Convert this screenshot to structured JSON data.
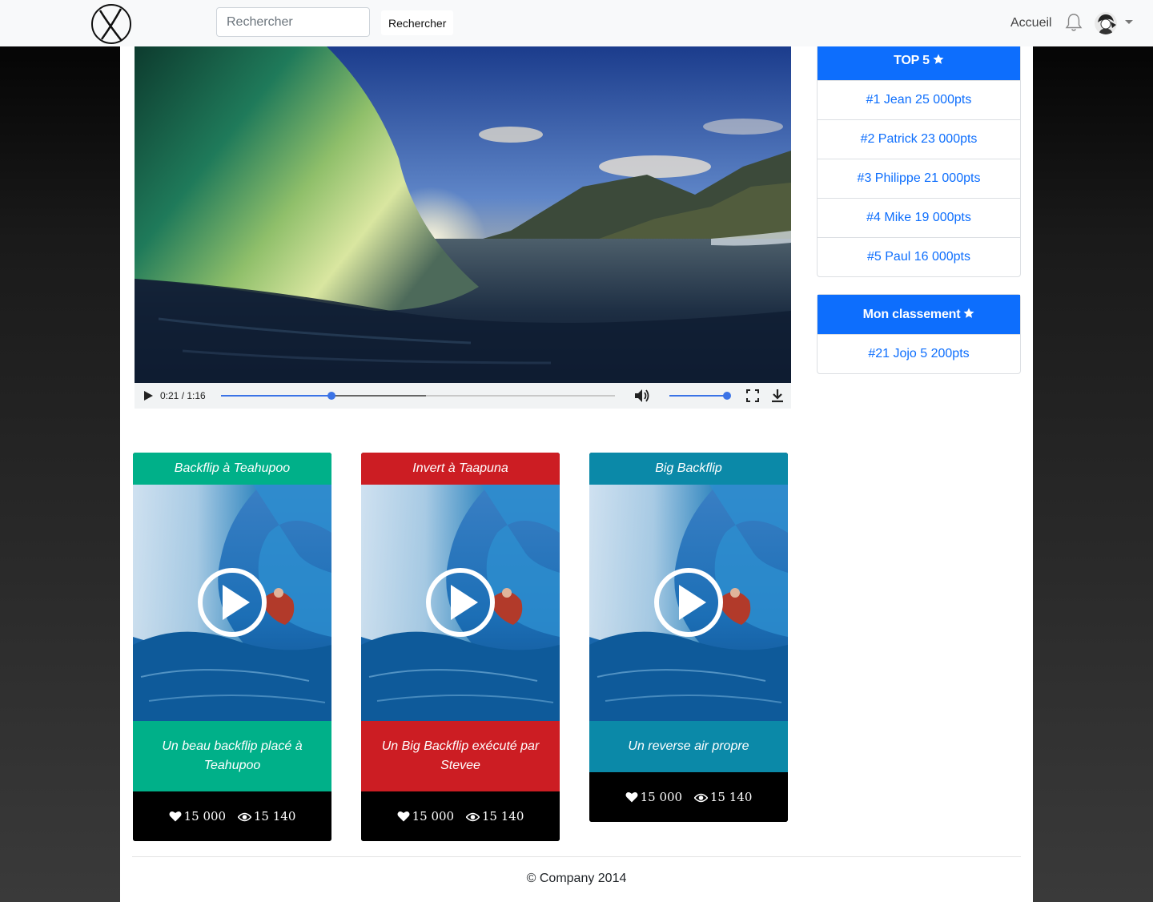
{
  "navbar": {
    "search_placeholder": "Rechercher",
    "search_button": "Rechercher",
    "home_link": "Accueil"
  },
  "video": {
    "current_time": "0:21",
    "duration": "1:16",
    "time_display": "0:21 / 1:16",
    "played_fraction": 0.28,
    "buffered_fraction": 0.52,
    "volume_fraction": 1.0
  },
  "top5": {
    "title": "TOP 5",
    "items": [
      "#1 Jean 25 000pts",
      "#2 Patrick 23 000pts",
      "#3 Philippe 21 000pts",
      "#4 Mike 19 000pts",
      "#5 Paul 16 000pts"
    ]
  },
  "my_rank": {
    "title": "Mon classement",
    "items": [
      "#21 Jojo 5 200pts"
    ]
  },
  "cards": [
    {
      "title": "Backflip à Teahupoo",
      "description": "Un beau backflip placé à Teahupoo",
      "likes": "15 000",
      "views": "15 140",
      "color": "#00b089"
    },
    {
      "title": "Invert à Taapuna",
      "description": "Un Big Backflip exécuté par Stevee",
      "likes": "15 000",
      "views": "15 140",
      "color": "#cc1d23"
    },
    {
      "title": "Big Backflip",
      "description": "Un reverse air propre",
      "likes": "15 000",
      "views": "15 140",
      "color": "#0b89a8"
    }
  ],
  "colors": {
    "primary": "#0d6efd",
    "progress": "#3b73e6"
  },
  "footer": {
    "text": "© Company 2014"
  }
}
